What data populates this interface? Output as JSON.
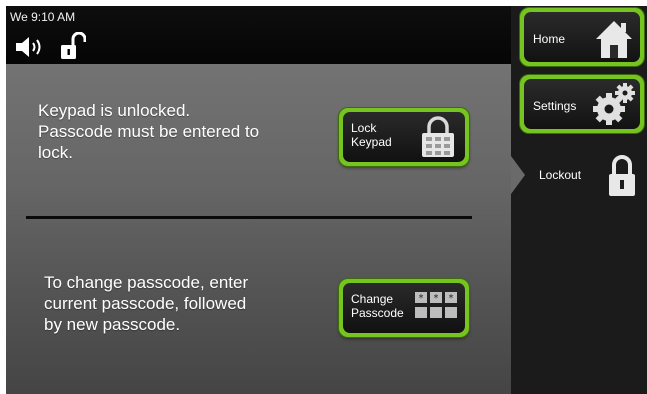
{
  "status": {
    "time": "We 9:10 AM",
    "icons": [
      "speaker-volume-icon",
      "unlocked-padlock-icon"
    ]
  },
  "main": {
    "lock_message": [
      "Keypad is unlocked.",
      "Passcode must be entered to",
      "lock."
    ],
    "lock_button": {
      "line1": "Lock",
      "line2": "Keypad",
      "icon": "padlock-keypad-icon"
    },
    "change_message": [
      "To change passcode, enter",
      "current passcode, followed",
      "by new passcode."
    ],
    "change_button": {
      "line1": "Change",
      "line2": "Passcode",
      "icon": "passcode-boxes-icon"
    }
  },
  "sidebar": {
    "home": {
      "label": "Home",
      "icon": "home-icon"
    },
    "settings": {
      "label": "Settings",
      "icon": "gear-icon"
    },
    "lockout": {
      "label": "Lockout",
      "icon": "padlock-icon",
      "selected": true
    }
  },
  "colors": {
    "accent_green": "#76c41f",
    "sidebar_bg": "#1b1b1b",
    "status_bg": "#050505"
  }
}
